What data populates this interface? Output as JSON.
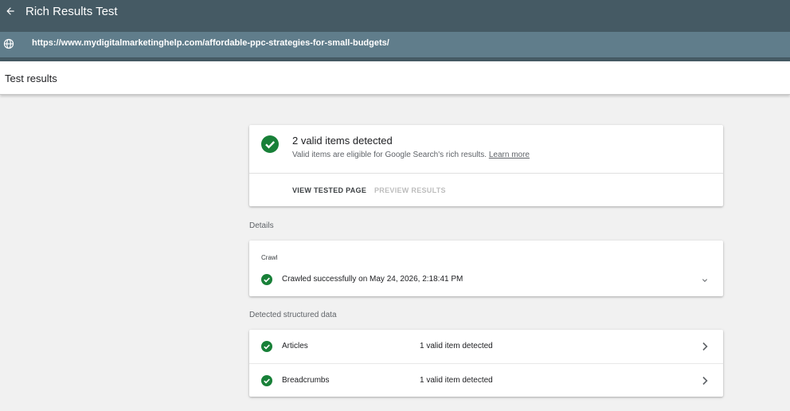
{
  "app": {
    "title": "Rich Results Test",
    "back_icon": "arrow-back-icon",
    "url": "https://www.mydigitalmarketinghelp.com/affordable-ppc-strategies-for-small-budgets/",
    "url_icon": "globe-icon"
  },
  "results": {
    "title": "Test results"
  },
  "summary": {
    "title": "2 valid items detected",
    "subtitle": "Valid items are eligible for Google Search's rich results.",
    "learn_more": "Learn more",
    "view_tested_page": "VIEW TESTED PAGE",
    "preview_results": "PREVIEW RESULTS",
    "status_icon": "check-circle-icon"
  },
  "details": {
    "label": "Details",
    "crawl": {
      "label": "Crawl",
      "status": "Crawled successfully on May 24, 2026, 2:18:41 PM",
      "expand_icon": "chevron-down-icon"
    }
  },
  "structured_data": {
    "label": "Detected structured data",
    "items": [
      {
        "name": "Articles",
        "status": "1 valid item detected"
      },
      {
        "name": "Breadcrumbs",
        "status": "1 valid item detected"
      }
    ]
  },
  "colors": {
    "appbar": "#455a64",
    "urlbar": "#607d8b",
    "valid_green": "#188038",
    "background": "#f1f1f1"
  }
}
